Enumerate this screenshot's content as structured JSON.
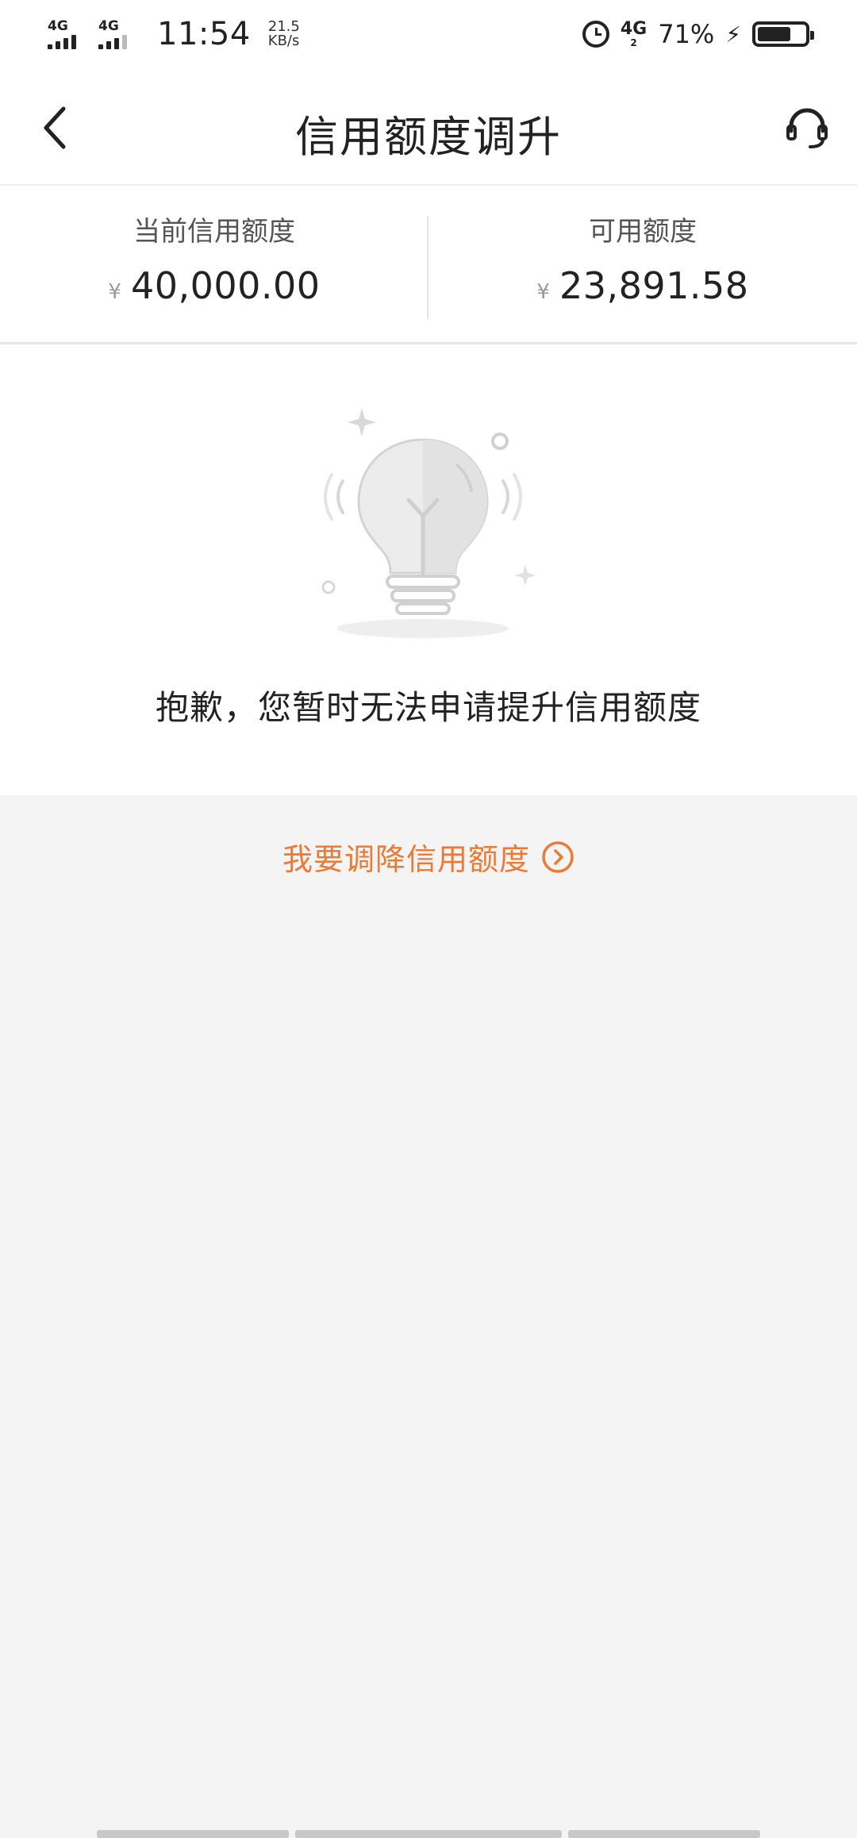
{
  "status_bar": {
    "sim1": "4G",
    "sim2": "4G",
    "time": "11:54",
    "speed_value": "21.5",
    "speed_unit": "KB/s",
    "network": "4G",
    "network_sub": "2",
    "battery_pct": "71%",
    "battery_level": 0.71,
    "icons": [
      "alarm-icon",
      "charging-bolt-icon",
      "battery-icon"
    ]
  },
  "nav": {
    "title": "信用额度调升",
    "back_icon": "chevron-left-icon",
    "service_icon": "headset-icon"
  },
  "summary": {
    "current_label": "当前信用额度",
    "current_currency": "¥",
    "current_amount": "40,000.00",
    "available_label": "可用额度",
    "available_currency": "¥",
    "available_amount": "23,891.58"
  },
  "result": {
    "illustration": "lightbulb-icon",
    "message": "抱歉，您暂时无法申请提升信用额度"
  },
  "lower_link": {
    "label": "我要调降信用额度",
    "icon": "chevron-right-circle-icon",
    "color": "#ec7a35"
  },
  "colors": {
    "accent": "#ec7a35",
    "background": "#f4f4f4",
    "card": "#ffffff"
  }
}
